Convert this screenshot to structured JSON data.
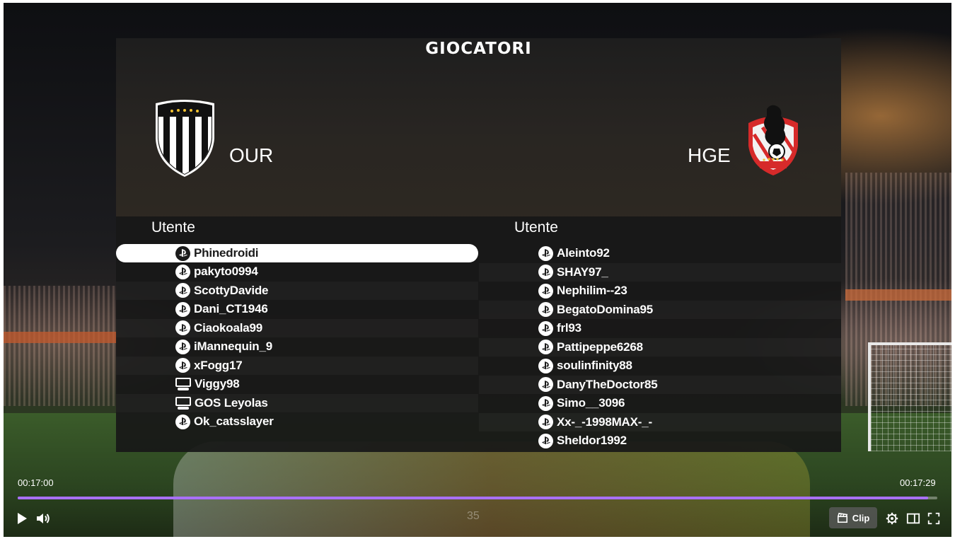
{
  "overlay": {
    "title": "GIOCATORI",
    "home_team": {
      "name": "OUR"
    },
    "away_team": {
      "name": "HGE"
    },
    "columns": {
      "left_header": "Utente",
      "right_header": "Utente"
    },
    "home_players": [
      {
        "name": "Phinedroidi",
        "platform": "playstation-icon",
        "selected": true
      },
      {
        "name": "pakyto0994",
        "platform": "playstation-icon"
      },
      {
        "name": "ScottyDavide",
        "platform": "playstation-icon"
      },
      {
        "name": "Dani_CT1946",
        "platform": "playstation-icon"
      },
      {
        "name": "Ciaokoala99",
        "platform": "playstation-icon"
      },
      {
        "name": "iMannequin_9",
        "platform": "playstation-icon"
      },
      {
        "name": "xFogg17",
        "platform": "playstation-icon"
      },
      {
        "name": "Viggy98",
        "platform": "pc-icon"
      },
      {
        "name": "GOS Leyolas",
        "platform": "pc-icon"
      },
      {
        "name": "Ok_catsslayer",
        "platform": "playstation-icon"
      }
    ],
    "away_players": [
      {
        "name": "Aleinto92",
        "platform": "playstation-icon"
      },
      {
        "name": "SHAY97_",
        "platform": "playstation-icon"
      },
      {
        "name": "Nephilim--23",
        "platform": "playstation-icon"
      },
      {
        "name": "BegatoDomina95",
        "platform": "playstation-icon"
      },
      {
        "name": "frl93",
        "platform": "playstation-icon"
      },
      {
        "name": "Pattipeppe6268",
        "platform": "playstation-icon"
      },
      {
        "name": "soulinfinity88",
        "platform": "playstation-icon"
      },
      {
        "name": "DanyTheDoctor85",
        "platform": "playstation-icon"
      },
      {
        "name": "Simo__3096",
        "platform": "playstation-icon"
      },
      {
        "name": "Xx-_-1998MAX-_-",
        "platform": "playstation-icon"
      },
      {
        "name": "Sheldor1992",
        "platform": "playstation-icon"
      }
    ]
  },
  "player": {
    "time_start": "00:17:00",
    "time_end": "00:17:29",
    "progress": 0.99,
    "counter": "35",
    "clip_label": "Clip",
    "accent_color": "#a970ff"
  }
}
